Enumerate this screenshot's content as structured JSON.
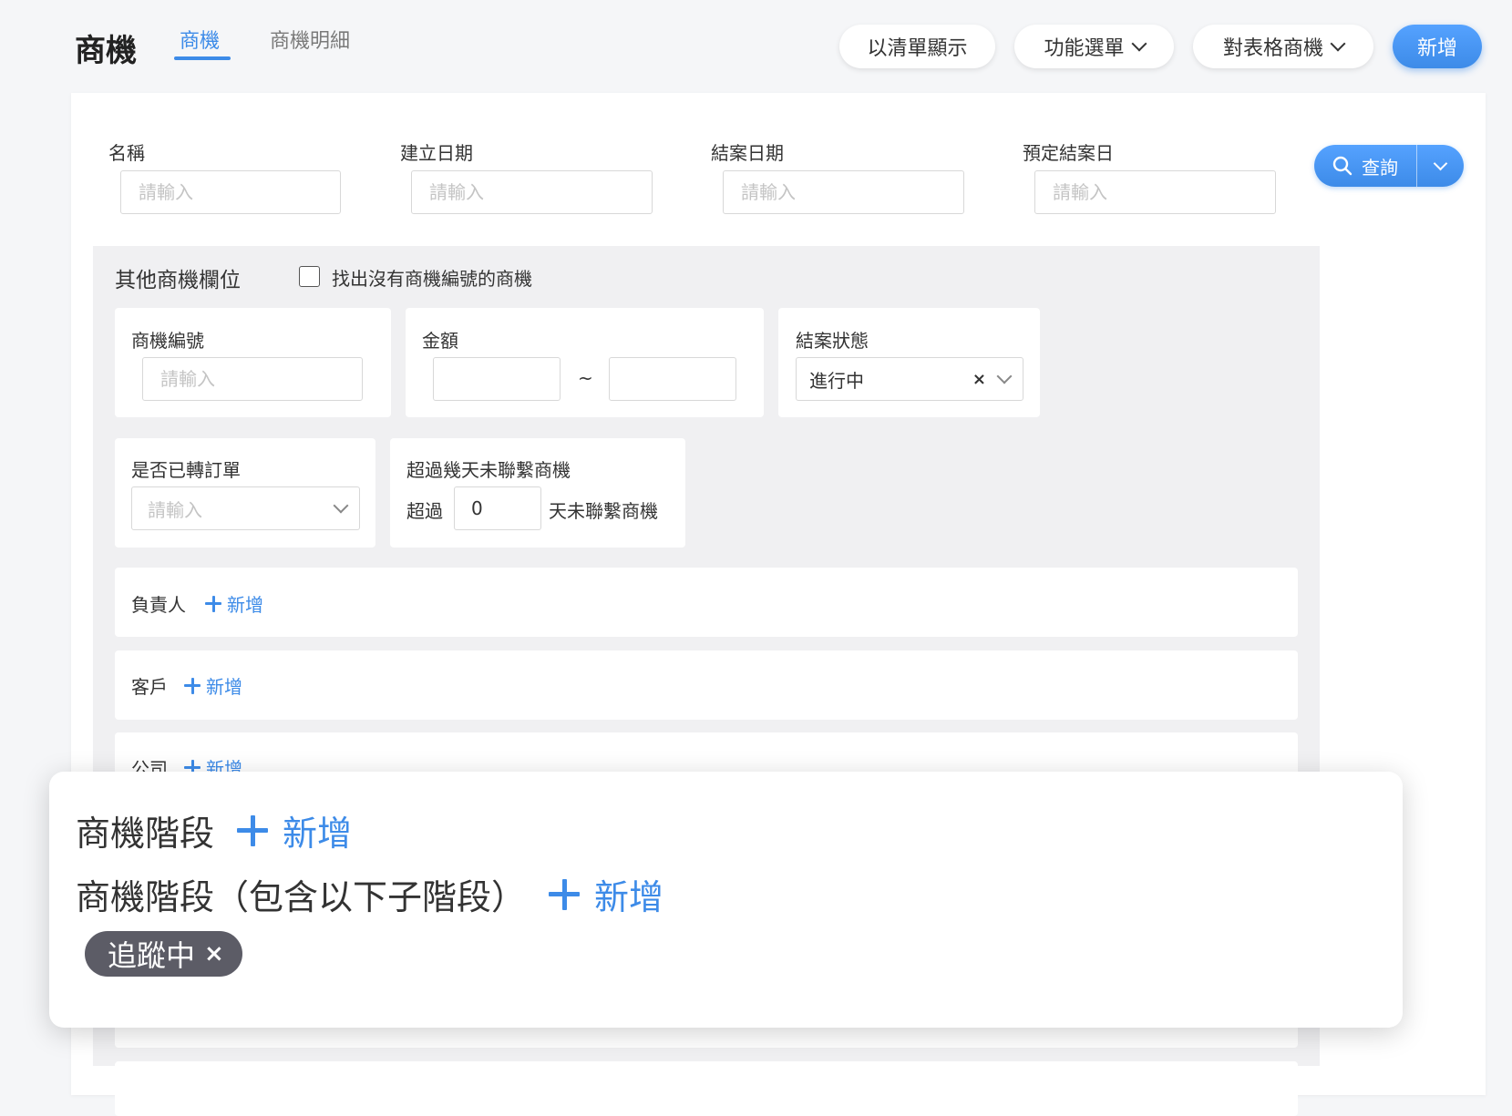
{
  "header": {
    "title": "商機",
    "tabs": [
      {
        "label": "商機",
        "active": true
      },
      {
        "label": "商機明細",
        "active": false
      }
    ],
    "buttons": {
      "list_view": "以清單顯示",
      "function_menu": "功能選單",
      "table_opportunity": "對表格商機",
      "add_new": "新增"
    }
  },
  "filters": {
    "name": {
      "label": "名稱",
      "placeholder": "請輸入"
    },
    "created_date": {
      "label": "建立日期",
      "placeholder": "請輸入"
    },
    "closed_date": {
      "label": "結案日期",
      "placeholder": "請輸入"
    },
    "expected_close": {
      "label": "預定結案日",
      "placeholder": "請輸入"
    },
    "query_label": "查詢"
  },
  "other_fields": {
    "title": "其他商機欄位",
    "checkbox_label": "找出沒有商機編號的商機",
    "checkbox_checked": false,
    "opportunity_no": {
      "label": "商機編號",
      "placeholder": "請輸入"
    },
    "amount": {
      "label": "金額",
      "from": "",
      "to": "",
      "separator": "~"
    },
    "close_status": {
      "label": "結案狀態",
      "value": "進行中",
      "clear": "×"
    },
    "converted_to_order": {
      "label": "是否已轉訂單",
      "placeholder": "請輸入"
    },
    "no_contact": {
      "label": "超過幾天未聯繫商機",
      "prefix": "超過",
      "value": "0",
      "suffix": "天未聯繫商機"
    },
    "owner": {
      "label": "負責人",
      "add": "新增"
    },
    "customer": {
      "label": "客戶",
      "add": "新增"
    },
    "company": {
      "label": "公司",
      "add": "新增"
    }
  },
  "zoom_panel": {
    "stage_label": "商機階段",
    "stage_add": "新增",
    "stage_sub_label": "商機階段（包含以下子階段）",
    "stage_sub_add": "新增",
    "chip": {
      "label": "追蹤中",
      "remove": "×"
    }
  },
  "colors": {
    "accent": "#3d8be8",
    "background": "#f5f6f8",
    "grey_area": "#f0f0f2",
    "chip": "#5c5c66"
  }
}
